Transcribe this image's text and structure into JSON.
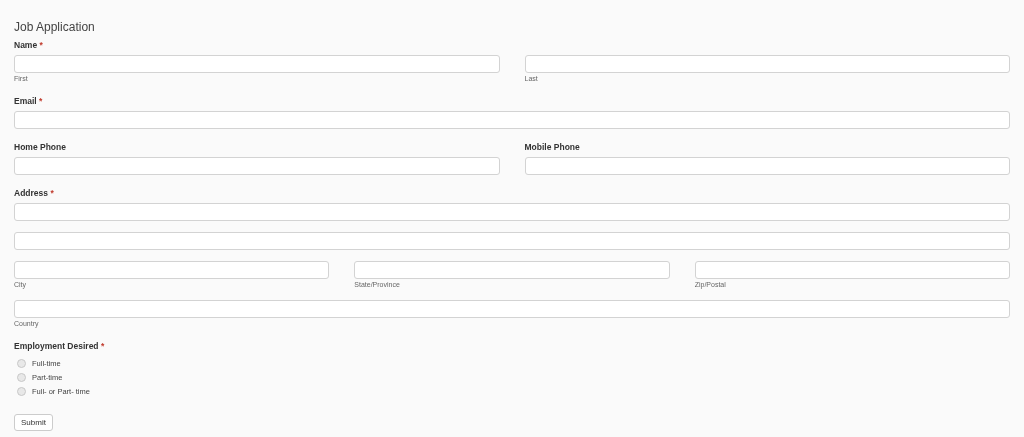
{
  "title": "Job Application",
  "sections": [
    {
      "kind": "fields",
      "columns": [
        {
          "label": "Name",
          "mark": "*",
          "lines": [
            [
              {
                "kind": "text",
                "sublabel": "First"
              },
              {
                "kind": "text",
                "sublabel": "Last"
              }
            ]
          ]
        }
      ]
    },
    {
      "kind": "fields",
      "columns": [
        {
          "label": "Email",
          "mark": "*",
          "lines": [
            [
              {
                "kind": "text"
              }
            ]
          ]
        }
      ]
    },
    {
      "kind": "fields",
      "columns": [
        {
          "label": "Home Phone",
          "lines": [
            [
              {
                "kind": "text"
              }
            ]
          ]
        },
        {
          "label": "Mobile Phone",
          "lines": [
            [
              {
                "kind": "text"
              }
            ]
          ]
        }
      ]
    },
    {
      "kind": "fields",
      "columns": [
        {
          "label": "Address",
          "mark": "*",
          "lines": [
            [
              {
                "kind": "text"
              }
            ],
            [
              {
                "kind": "text"
              }
            ],
            [
              {
                "kind": "text",
                "sublabel": "City"
              },
              {
                "kind": "text",
                "sublabel": "State/Province"
              },
              {
                "kind": "text",
                "sublabel": "Zip/Postal"
              }
            ],
            [
              {
                "kind": "text",
                "sublabel": "Country"
              }
            ]
          ]
        }
      ]
    },
    {
      "kind": "radios",
      "label": "Employment Desired",
      "mark": "*",
      "options": [
        {
          "label": "Full-time",
          "selected": false
        },
        {
          "label": "Part-time",
          "selected": false
        },
        {
          "label": "Full- or Part- time",
          "selected": false
        }
      ]
    }
  ],
  "submit": "Submit"
}
